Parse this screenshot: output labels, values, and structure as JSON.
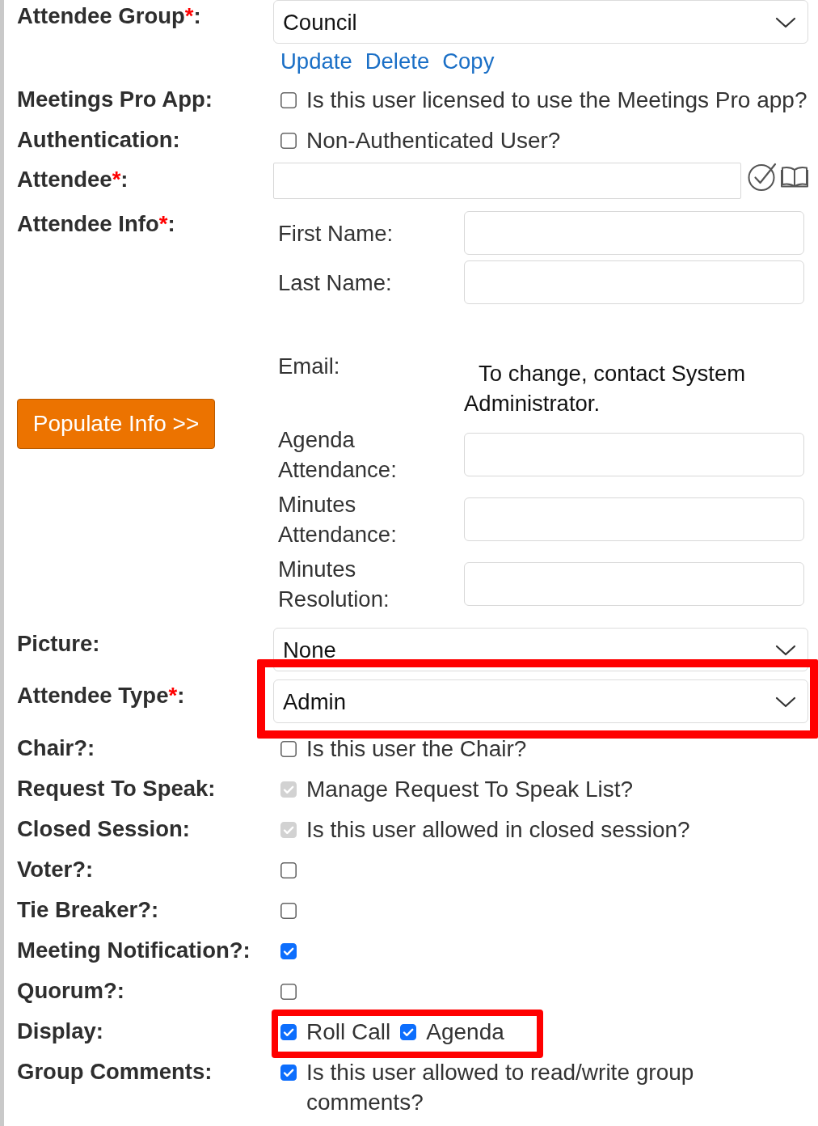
{
  "form": {
    "rows": [
      {
        "kind": "select",
        "label": "Attendee Group",
        "required_mark": "*",
        "label_end": ":",
        "value": "Council",
        "links": [
          "Update",
          "Delete",
          "Copy"
        ],
        "highlighted": false
      },
      {
        "kind": "checkbox",
        "label": "Meetings Pro App:",
        "highlighted": false,
        "options": [
          {
            "text": "Is this user licensed to use the Meetings Pro app?",
            "checked": false,
            "disabled": false
          }
        ]
      },
      {
        "kind": "checkbox",
        "label": "Authentication:",
        "highlighted": false,
        "options": [
          {
            "text": "Non-Authenticated User?",
            "checked": false,
            "disabled": false
          }
        ]
      },
      {
        "kind": "lookup",
        "label": "Attendee",
        "required_mark": "*",
        "label_end": ":"
      },
      {
        "kind": "info",
        "label": "Attendee Info",
        "required_mark": "*",
        "label_end": ":",
        "button": "Populate Info >>",
        "fields": [
          {
            "kind": "input",
            "label": "First Name:"
          },
          {
            "kind": "input",
            "label": "Last Name:"
          },
          {
            "kind": "note",
            "label": "Email:",
            "text": "To change, contact System Administrator."
          },
          {
            "kind": "input",
            "label": "Agenda Attendance:"
          },
          {
            "kind": "input",
            "label": "Minutes Attendance:"
          },
          {
            "kind": "input",
            "label": "Minutes Resolution:"
          }
        ]
      },
      {
        "kind": "select",
        "label": "Picture:",
        "value": "None",
        "highlighted": false
      },
      {
        "kind": "select",
        "label": "Attendee Type",
        "required_mark": "*",
        "label_end": ":",
        "value": "Admin",
        "highlighted": true
      },
      {
        "kind": "checkbox",
        "label": "Chair?:",
        "highlighted": false,
        "options": [
          {
            "text": "Is this user the Chair?",
            "checked": false,
            "disabled": false
          }
        ]
      },
      {
        "kind": "checkbox",
        "label": "Request To Speak:",
        "highlighted": false,
        "options": [
          {
            "text": "Manage Request To Speak List?",
            "checked": true,
            "disabled": true
          }
        ]
      },
      {
        "kind": "checkbox",
        "label": "Closed Session:",
        "highlighted": false,
        "options": [
          {
            "text": "Is this user allowed in closed session?",
            "checked": true,
            "disabled": true
          }
        ]
      },
      {
        "kind": "checkbox",
        "label": "Voter?:",
        "highlighted": false,
        "options": [
          {
            "checked": false,
            "disabled": false
          }
        ]
      },
      {
        "kind": "checkbox",
        "label": "Tie Breaker?:",
        "highlighted": false,
        "options": [
          {
            "checked": false,
            "disabled": false
          }
        ]
      },
      {
        "kind": "checkbox",
        "label": "Meeting Notification?:",
        "highlighted": false,
        "options": [
          {
            "checked": true,
            "disabled": false
          }
        ]
      },
      {
        "kind": "checkbox",
        "label": "Quorum?:",
        "highlighted": false,
        "options": [
          {
            "checked": false,
            "disabled": false
          }
        ]
      },
      {
        "kind": "checkbox",
        "label": "Display:",
        "highlighted": true,
        "options": [
          {
            "text": "Roll Call",
            "checked": true,
            "disabled": false
          },
          {
            "text": "Agenda",
            "checked": true,
            "disabled": false
          }
        ]
      },
      {
        "kind": "checkbox",
        "label": "Group Comments:",
        "highlighted": false,
        "options": [
          {
            "text": "Is this user allowed to read/write group comments?",
            "checked": true,
            "disabled": false
          }
        ]
      }
    ]
  }
}
